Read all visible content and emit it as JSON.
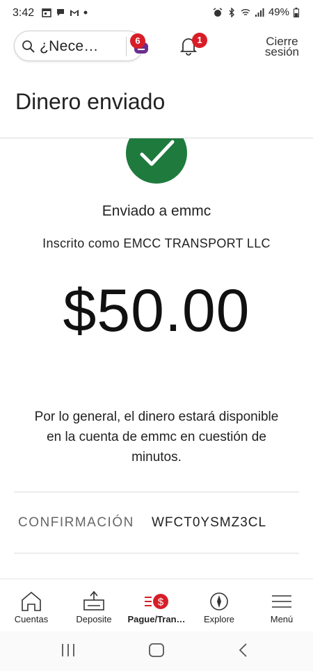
{
  "status_bar": {
    "time": "3:42",
    "battery": "49%",
    "icons": [
      "calendar-icon",
      "chat-icon",
      "gmail-icon",
      "dot-icon",
      "alarm-icon",
      "bluetooth-icon",
      "wifi-icon",
      "signal-icon",
      "battery-icon"
    ]
  },
  "header": {
    "search_text": "¿Nece…",
    "fargo_badge": "6",
    "bell_badge": "1",
    "logout_line1": "Cierre",
    "logout_line2": "sesión"
  },
  "page": {
    "title": "Dinero enviado"
  },
  "confirmation": {
    "sent_to": "Enviado a emmc",
    "enrolled": "Inscrito como EMCC TRANSPORT LLC",
    "amount": "$50.00",
    "note": "Por lo general, el dinero estará disponible en la cuenta de emmc en cuestión de minutos.",
    "label": "CONFIRMACIÓN",
    "code": "WFCT0YSMZ3CL",
    "success_color": "#1f7a3d"
  },
  "bottom_nav": {
    "items": [
      {
        "label": "Cuentas",
        "icon": "house-icon"
      },
      {
        "label": "Deposite",
        "icon": "deposit-icon"
      },
      {
        "label": "Pague/Tran…",
        "icon": "pay-transfer-icon"
      },
      {
        "label": "Explore",
        "icon": "compass-icon"
      },
      {
        "label": "Menú",
        "icon": "hamburger-menu-icon"
      }
    ],
    "active_index": 2,
    "accent": "#d71e28"
  },
  "system_nav": {
    "icons": [
      "recent-apps-icon",
      "home-icon",
      "back-icon"
    ]
  }
}
